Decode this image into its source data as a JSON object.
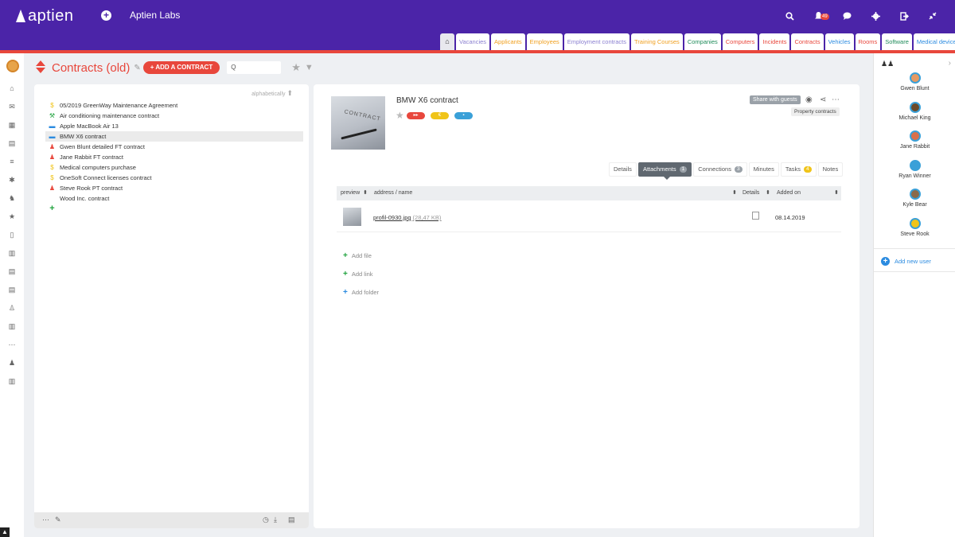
{
  "app": {
    "logo_text": "aptien",
    "company": "Aptien Labs",
    "notification_count": "49"
  },
  "top_tabs": [
    {
      "label": "Vacancies",
      "color": "#8a7fd0"
    },
    {
      "label": "Applicants",
      "color": "#f0a020"
    },
    {
      "label": "Employees",
      "color": "#f0a020"
    },
    {
      "label": "Employment contracts",
      "color": "#8a7fd0"
    },
    {
      "label": "Training Courses",
      "color": "#f0a020"
    },
    {
      "label": "Companies",
      "color": "#1f8b5a"
    },
    {
      "label": "Computers",
      "color": "#e8473c"
    },
    {
      "label": "Incidents",
      "color": "#e8473c"
    },
    {
      "label": "Contracts",
      "color": "#e8473c"
    },
    {
      "label": "Vehicles",
      "color": "#2b8be0"
    },
    {
      "label": "Rooms",
      "color": "#e8473c"
    },
    {
      "label": "Software",
      "color": "#1f8b5a"
    },
    {
      "label": "Medical devices",
      "color": "#2b8be0"
    }
  ],
  "page": {
    "title": "Contracts (old)",
    "add_button": "+ ADD A CONTRACT",
    "search_icon": "Q",
    "sort_label": "alphabetically"
  },
  "contracts": [
    {
      "label": "05/2019 GreenWay Maintenance Agreement",
      "icon": "coins-icon",
      "glyph": "$",
      "color": "#f0c419",
      "selected": false
    },
    {
      "label": "Air conditioning maintenance contract",
      "icon": "wrench-icon",
      "glyph": "⚒",
      "color": "#1fa23d",
      "selected": false
    },
    {
      "label": "Apple MacBook Air 13",
      "icon": "car-icon",
      "glyph": "▬",
      "color": "#2b8be0",
      "selected": false
    },
    {
      "label": "BMW X6 contract",
      "icon": "car-icon",
      "glyph": "▬",
      "color": "#2b8be0",
      "selected": true
    },
    {
      "label": "Gwen Blunt detailed FT contract",
      "icon": "people-icon",
      "glyph": "♟",
      "color": "#e8473c",
      "selected": false
    },
    {
      "label": "Jane Rabbit FT contract",
      "icon": "people-icon",
      "glyph": "♟",
      "color": "#e8473c",
      "selected": false
    },
    {
      "label": "Medical computers purchase",
      "icon": "coins-icon",
      "glyph": "$",
      "color": "#f0c419",
      "selected": false
    },
    {
      "label": "OneSoft Connect licenses contract",
      "icon": "coins-icon",
      "glyph": "$",
      "color": "#f0c419",
      "selected": false
    },
    {
      "label": "Steve Rook PT contract",
      "icon": "people-icon",
      "glyph": "♟",
      "color": "#e8473c",
      "selected": false
    },
    {
      "label": "Wood Inc. contract",
      "icon": "",
      "glyph": "",
      "color": "#333",
      "selected": false
    }
  ],
  "detail": {
    "title": "BMW X6 contract",
    "thumb_text": "CONTRACT",
    "pills": [
      {
        "glyph": "▸▸",
        "color": "#e8473c"
      },
      {
        "glyph": "€",
        "color": "#f0c419"
      },
      {
        "glyph": "▪",
        "color": "#3aa0d8"
      }
    ],
    "share_label": "Share with guests",
    "category_label": "Property contracts",
    "tabs": [
      {
        "label": "Details",
        "count": "",
        "active": false
      },
      {
        "label": "Attachments",
        "count": "1",
        "active": true
      },
      {
        "label": "Connections",
        "count": "3",
        "active": false
      },
      {
        "label": "Minutes",
        "count": "",
        "active": false
      },
      {
        "label": "Tasks",
        "count": "4",
        "active": false
      },
      {
        "label": "Notes",
        "count": "",
        "active": false
      }
    ],
    "table": {
      "col_preview": "preview",
      "col_address": "address / name",
      "col_details": "Details",
      "col_added": "Added on",
      "rows": [
        {
          "name": "profil-0930.jpg",
          "size": "(28,47 KB)",
          "added": "08.14.2019"
        }
      ]
    },
    "actions": {
      "add_file": "Add file",
      "add_link": "Add link",
      "add_folder": "Add folder"
    }
  },
  "users": [
    {
      "name": "Gwen Blunt",
      "color": "#e69a63"
    },
    {
      "name": "Michael King",
      "color": "#6b4a2a"
    },
    {
      "name": "Jane Rabbit",
      "color": "#d9704a"
    },
    {
      "name": "Ryan Winner",
      "color": "#3aa0d8"
    },
    {
      "name": "Kyle Bear",
      "color": "#8a6a4a"
    },
    {
      "name": "Steve Rook",
      "color": "#f0c419"
    }
  ],
  "add_user_label": "Add new user"
}
